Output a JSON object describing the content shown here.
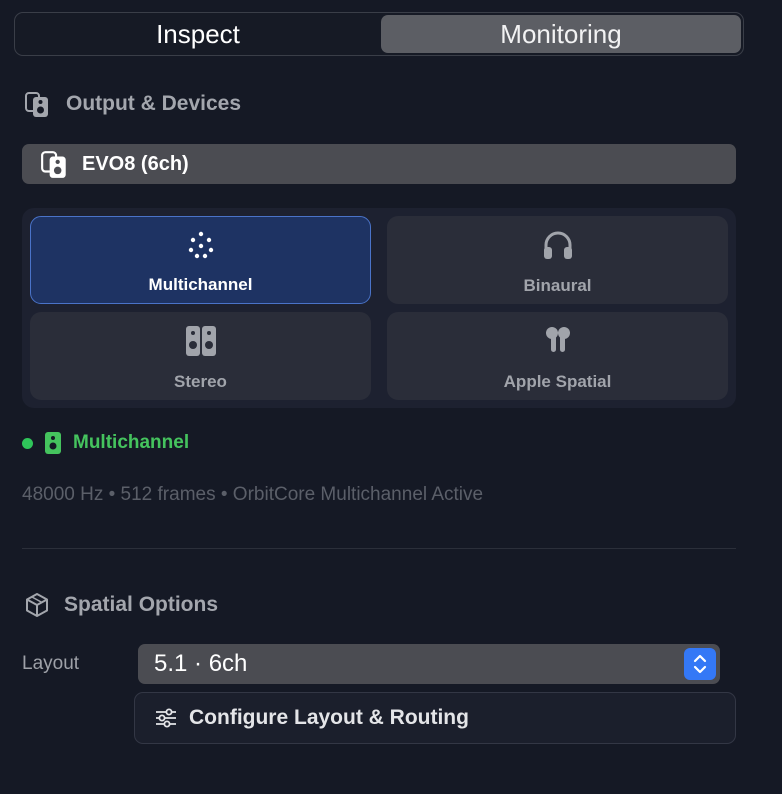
{
  "tabs": [
    {
      "label": "Inspect",
      "selected": false
    },
    {
      "label": "Monitoring",
      "selected": true
    }
  ],
  "output_section": {
    "title": "Output & Devices",
    "icon": "speaker-icon",
    "device": {
      "label": "EVO8 (6ch)",
      "icon": "speaker-icon"
    }
  },
  "modes": [
    {
      "label": "Multichannel",
      "icon": "dots-surround-icon",
      "active": true
    },
    {
      "label": "Binaural",
      "icon": "headphones-icon",
      "active": false
    },
    {
      "label": "Stereo",
      "icon": "stereo-speakers-icon",
      "active": false
    },
    {
      "label": "Apple Spatial",
      "icon": "airpods-icon",
      "active": false
    }
  ],
  "status": {
    "label": "Multichannel",
    "color": "#45c35e",
    "info": "48000 Hz • 512 frames • OrbitCore Multichannel Active"
  },
  "spatial_section": {
    "title": "Spatial Options",
    "icon": "cube-icon",
    "layout_label": "Layout",
    "layout_value": "5.1 · 6ch",
    "configure_button": "Configure Layout & Routing"
  },
  "colors": {
    "background": "#151925",
    "accent": "#3478f6",
    "active_mode": "#1e3363",
    "status_green": "#45c35e"
  }
}
